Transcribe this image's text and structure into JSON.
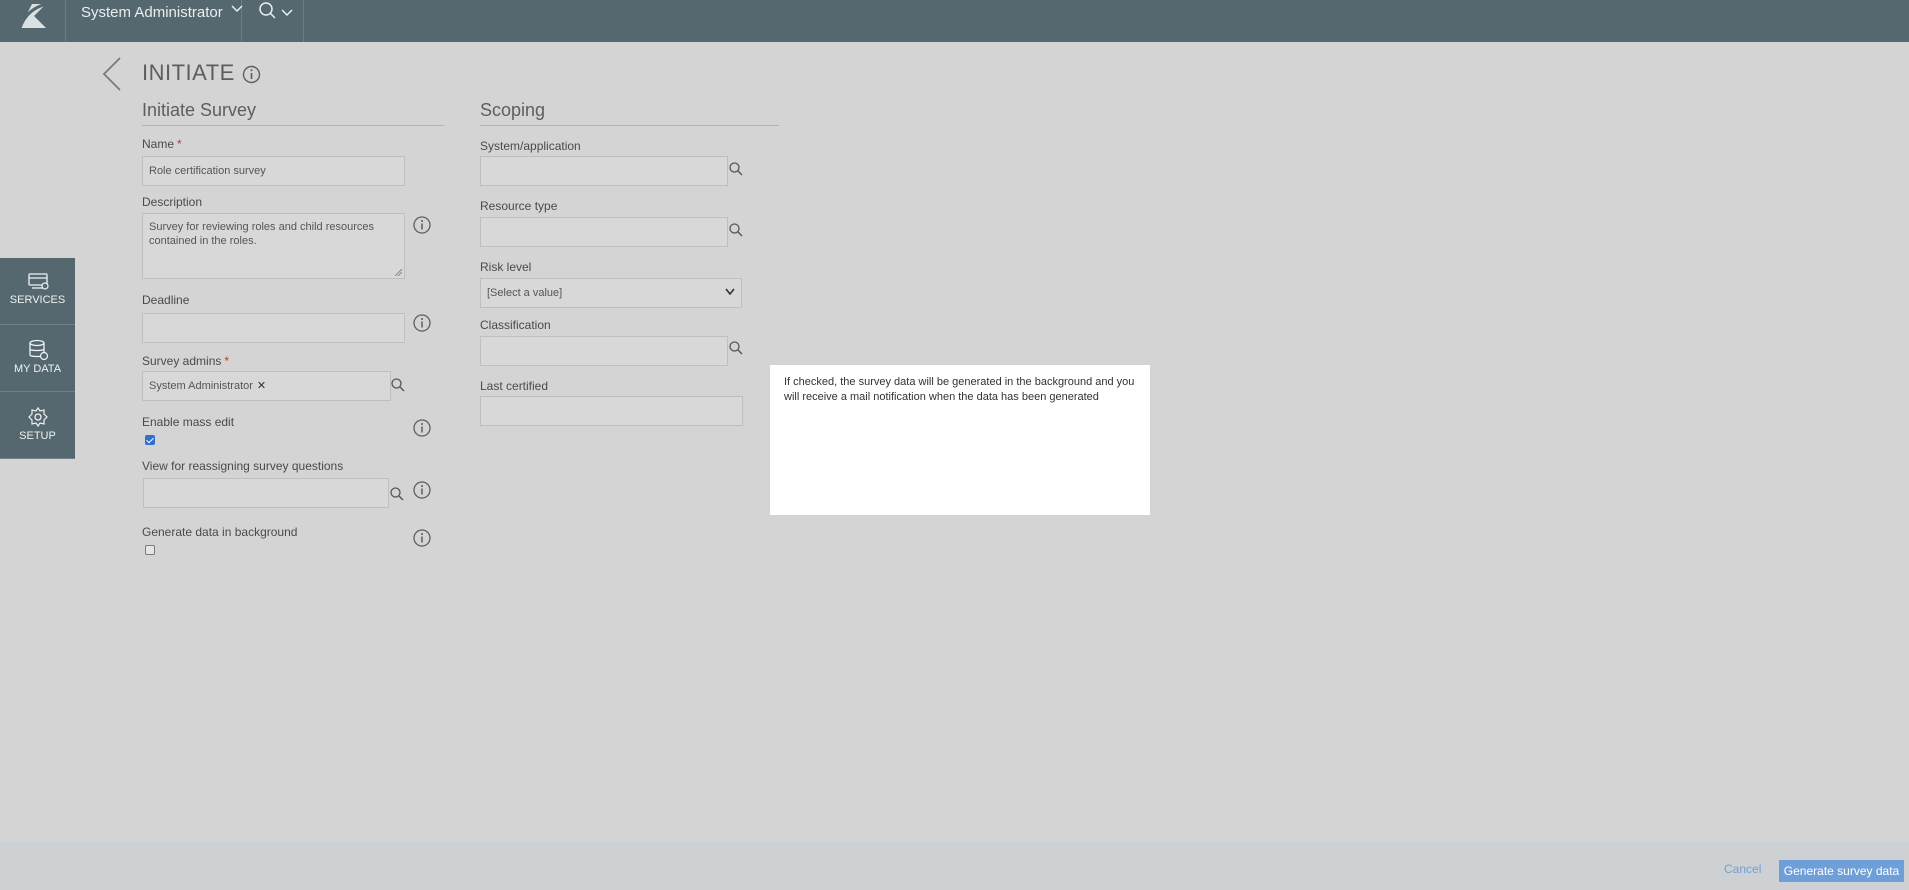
{
  "topbar": {
    "user_name": "System Administrator"
  },
  "sidebar": {
    "items": [
      {
        "label": "SERVICES",
        "icon": "services-icon"
      },
      {
        "label": "MY DATA",
        "icon": "database-icon"
      },
      {
        "label": "SETUP",
        "icon": "gear-icon"
      }
    ]
  },
  "page": {
    "title": "INITIATE"
  },
  "initiate": {
    "section_title": "Initiate Survey",
    "name_label": "Name",
    "name_value": "Role certification survey",
    "description_label": "Description",
    "description_value": "Survey for reviewing roles and child resources contained in the roles.",
    "deadline_label": "Deadline",
    "deadline_value": "",
    "survey_admins_label": "Survey admins",
    "survey_admins_tag": "System Administrator",
    "survey_admins_remove": "✕",
    "enable_mass_edit_label": "Enable mass edit",
    "enable_mass_edit_checked": true,
    "view_reassign_label": "View for reassigning survey questions",
    "view_reassign_value": "",
    "generate_background_label": "Generate data in background",
    "generate_background_checked": false,
    "required_mark": "*"
  },
  "scoping": {
    "section_title": "Scoping",
    "system_label": "System/application",
    "system_value": "",
    "resource_type_label": "Resource type",
    "resource_type_value": "",
    "risk_level_label": "Risk level",
    "risk_level_value": "[Select a value]",
    "classification_label": "Classification",
    "classification_value": "",
    "last_certified_label": "Last certified",
    "last_certified_value": ""
  },
  "tooltip": {
    "text": "If checked, the survey data will be generated in the background and you will receive a mail notification when the data has been generated"
  },
  "footer": {
    "cancel_label": "Cancel",
    "primary_label": "Generate survey data"
  },
  "colors": {
    "topbar": "#56686f",
    "background": "#d4d4d4",
    "accent": "#6f9fd8",
    "required": "#c0392b"
  }
}
